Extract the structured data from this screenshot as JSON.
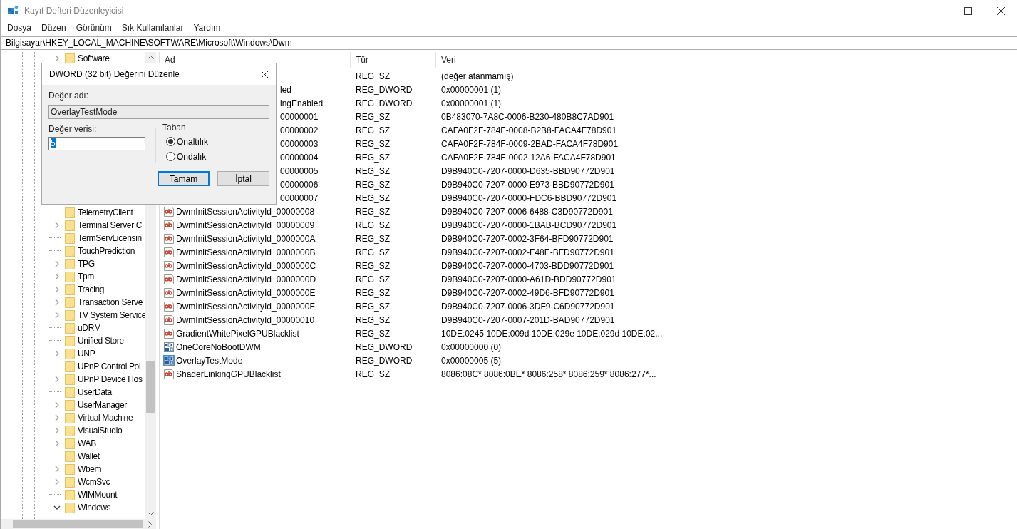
{
  "window": {
    "title": "Kayıt Defteri Düzenleyicisi"
  },
  "menu": [
    "Dosya",
    "Düzen",
    "Görünüm",
    "Sık Kullanılanlar",
    "Yardım"
  ],
  "address": "Bilgisayar\\HKEY_LOCAL_MACHINE\\SOFTWARE\\Microsoft\\Windows\\Dwm",
  "tree": {
    "items": [
      {
        "label": "Software",
        "expandable": true,
        "expanded": false
      },
      {
        "label": "TelemetryClient",
        "expandable": false,
        "expanded": false
      },
      {
        "label": "Terminal Server C",
        "expandable": true,
        "expanded": false
      },
      {
        "label": "TermServLicensin",
        "expandable": false,
        "expanded": false
      },
      {
        "label": "TouchPrediction",
        "expandable": false,
        "expanded": false
      },
      {
        "label": "TPG",
        "expandable": true,
        "expanded": false
      },
      {
        "label": "Tpm",
        "expandable": true,
        "expanded": false
      },
      {
        "label": "Tracing",
        "expandable": true,
        "expanded": false
      },
      {
        "label": "Transaction Serve",
        "expandable": true,
        "expanded": false
      },
      {
        "label": "TV System Service",
        "expandable": true,
        "expanded": false
      },
      {
        "label": "uDRM",
        "expandable": false,
        "expanded": false
      },
      {
        "label": "Unified Store",
        "expandable": false,
        "expanded": false
      },
      {
        "label": "UNP",
        "expandable": true,
        "expanded": false
      },
      {
        "label": "UPnP Control Poi",
        "expandable": false,
        "expanded": false
      },
      {
        "label": "UPnP Device Hos",
        "expandable": true,
        "expanded": false
      },
      {
        "label": "UserData",
        "expandable": false,
        "expanded": false
      },
      {
        "label": "UserManager",
        "expandable": true,
        "expanded": false
      },
      {
        "label": "Virtual Machine",
        "expandable": true,
        "expanded": false
      },
      {
        "label": "VisualStudio",
        "expandable": true,
        "expanded": false
      },
      {
        "label": "WAB",
        "expandable": true,
        "expanded": false
      },
      {
        "label": "Wallet",
        "expandable": false,
        "expanded": false
      },
      {
        "label": "Wbem",
        "expandable": true,
        "expanded": false
      },
      {
        "label": "WcmSvc",
        "expandable": true,
        "expanded": false
      },
      {
        "label": "WIMMount",
        "expandable": false,
        "expanded": false
      },
      {
        "label": "Windows",
        "expandable": true,
        "expanded": true
      }
    ]
  },
  "table": {
    "columns": [
      "Ad",
      "Tür",
      "Veri"
    ],
    "rows": [
      {
        "covered": true,
        "type": "REG_SZ",
        "data": "(değer atanmamış)",
        "selected": false
      },
      {
        "covered": true,
        "name": "led",
        "type": "REG_DWORD",
        "data": "0x00000001 (1)",
        "selected": false
      },
      {
        "covered": true,
        "name": "ingEnabled",
        "type": "REG_DWORD",
        "data": "0x00000001 (1)",
        "selected": false
      },
      {
        "covered": true,
        "name": "00000001",
        "type": "REG_SZ",
        "data": "0B483070-7A8C-0006-B230-480B8C7AD901",
        "selected": false
      },
      {
        "covered": true,
        "name": "00000002",
        "type": "REG_SZ",
        "data": "CAFA0F2F-784F-0008-B2B8-FACA4F78D901",
        "selected": false
      },
      {
        "covered": true,
        "name": "00000003",
        "type": "REG_SZ",
        "data": "CAFA0F2F-784F-0009-2BAD-FACA4F78D901",
        "selected": false
      },
      {
        "covered": true,
        "name": "00000004",
        "type": "REG_SZ",
        "data": "CAFA0F2F-784F-0002-12A6-FACA4F78D901",
        "selected": false
      },
      {
        "covered": true,
        "name": "00000005",
        "type": "REG_SZ",
        "data": "D9B940C0-7207-0000-D635-BBD90772D901",
        "selected": false
      },
      {
        "covered": true,
        "name": "00000006",
        "type": "REG_SZ",
        "data": "D9B940C0-7207-0000-E973-BBD90772D901",
        "selected": false
      },
      {
        "covered": true,
        "name": "00000007",
        "type": "REG_SZ",
        "data": "D9B940C0-7207-0000-FDC6-BBD90772D901",
        "selected": false
      },
      {
        "kind": "string",
        "covered": false,
        "name": "DwmInitSessionActivityId_00000008",
        "type": "REG_SZ",
        "data": "D9B940C0-7207-0006-6488-C3D90772D901",
        "selected": false
      },
      {
        "kind": "string",
        "covered": false,
        "name": "DwmInitSessionActivityId_00000009",
        "type": "REG_SZ",
        "data": "D9B940C0-7207-0000-1BAB-BCD90772D901",
        "selected": false
      },
      {
        "kind": "string",
        "covered": false,
        "name": "DwmInitSessionActivityId_0000000A",
        "type": "REG_SZ",
        "data": "D9B940C0-7207-0002-3F64-BFD90772D901",
        "selected": false
      },
      {
        "kind": "string",
        "covered": false,
        "name": "DwmInitSessionActivityId_0000000B",
        "type": "REG_SZ",
        "data": "D9B940C0-7207-0002-F48E-BFD90772D901",
        "selected": false
      },
      {
        "kind": "string",
        "covered": false,
        "name": "DwmInitSessionActivityId_0000000C",
        "type": "REG_SZ",
        "data": "D9B940C0-7207-0000-4703-BDD90772D901",
        "selected": false
      },
      {
        "kind": "string",
        "covered": false,
        "name": "DwmInitSessionActivityId_0000000D",
        "type": "REG_SZ",
        "data": "D9B940C0-7207-0000-A61D-BDD90772D901",
        "selected": false
      },
      {
        "kind": "string",
        "covered": false,
        "name": "DwmInitSessionActivityId_0000000E",
        "type": "REG_SZ",
        "data": "D9B940C0-7207-0002-49D6-BFD90772D901",
        "selected": false
      },
      {
        "kind": "string",
        "covered": false,
        "name": "DwmInitSessionActivityId_0000000F",
        "type": "REG_SZ",
        "data": "D9B940C0-7207-0006-3DF9-C6D90772D901",
        "selected": false
      },
      {
        "kind": "string",
        "covered": false,
        "name": "DwmInitSessionActivityId_00000010",
        "type": "REG_SZ",
        "data": "D9B940C0-7207-0007-201D-BAD90772D901",
        "selected": false
      },
      {
        "kind": "string",
        "covered": false,
        "name": "GradientWhitePixelGPUBlacklist",
        "type": "REG_SZ",
        "data": "10DE:0245 10DE:009d 10DE:029e 10DE:029d 10DE:02...",
        "selected": false
      },
      {
        "kind": "binary",
        "covered": false,
        "name": "OneCoreNoBootDWM",
        "type": "REG_DWORD",
        "data": "0x00000000 (0)",
        "selected": false
      },
      {
        "kind": "binary",
        "covered": false,
        "name": "OverlayTestMode",
        "type": "REG_DWORD",
        "data": "0x00000005 (5)",
        "selected": true
      },
      {
        "kind": "string",
        "covered": false,
        "name": "ShaderLinkingGPUBlacklist",
        "type": "REG_SZ",
        "data": "8086:08C* 8086:0BE* 8086:258* 8086:259* 8086:277*...",
        "selected": false
      }
    ]
  },
  "dialog": {
    "title": "DWORD (32 bit) Değerini Düzenle",
    "name_label": "Değer adı:",
    "name_value": "OverlayTestMode",
    "data_label": "Değer verisi:",
    "data_value": "5",
    "base_group": "Taban",
    "base_options": [
      {
        "label": "Onaltılık",
        "selected": true
      },
      {
        "label": "Ondalık",
        "selected": false
      }
    ],
    "buttons": [
      {
        "label": "Tamam",
        "default": true
      },
      {
        "label": "İptal",
        "default": false
      }
    ]
  }
}
